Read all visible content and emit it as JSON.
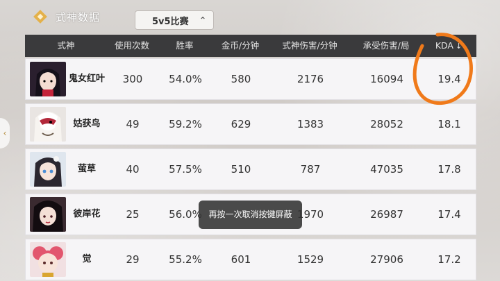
{
  "header": {
    "title": "式神数据",
    "mode": "5v5比赛"
  },
  "table": {
    "columns": [
      "式神",
      "使用次数",
      "胜率",
      "金币/分钟",
      "式神伤害/分钟",
      "承受伤害/局",
      "KDA"
    ],
    "sort_indicator": "↓",
    "rows": [
      {
        "name": "鬼女红叶",
        "uses": "300",
        "winrate": "54.0%",
        "gold": "580",
        "dmg": "2176",
        "taken": "16094",
        "kda": "19.4"
      },
      {
        "name": "姑获鸟",
        "uses": "49",
        "winrate": "59.2%",
        "gold": "629",
        "dmg": "1383",
        "taken": "28052",
        "kda": "18.1"
      },
      {
        "name": "萤草",
        "uses": "40",
        "winrate": "57.5%",
        "gold": "510",
        "dmg": "787",
        "taken": "47035",
        "kda": "17.8"
      },
      {
        "name": "彼岸花",
        "uses": "25",
        "winrate": "56.0%",
        "gold": "",
        "dmg": "1970",
        "taken": "26987",
        "kda": "17.4"
      },
      {
        "name": "觉",
        "uses": "29",
        "winrate": "55.2%",
        "gold": "601",
        "dmg": "1529",
        "taken": "27906",
        "kda": "17.2"
      }
    ]
  },
  "toast": "再按一次取消按键屏蔽",
  "colors": {
    "header_bg": "#3a3a3c",
    "row_bg": "#f6f5f7",
    "annotation": "#f07a1a",
    "title_icon": "#e4b14a"
  }
}
